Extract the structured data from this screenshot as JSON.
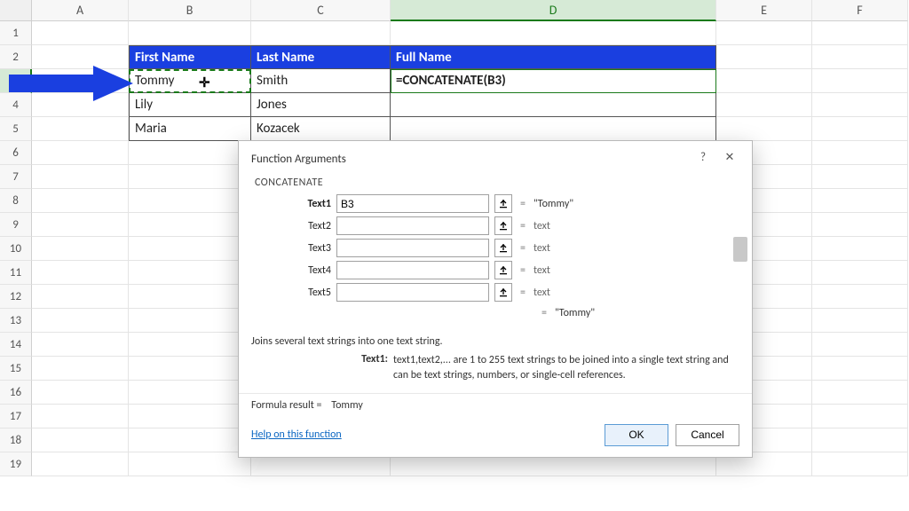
{
  "grid": {
    "columns": [
      "A",
      "B",
      "C",
      "D",
      "E",
      "F"
    ],
    "rows": 19,
    "header": {
      "first": "First Name",
      "last": "Last Name",
      "full": "Full Name"
    },
    "data": [
      {
        "first": "Tommy",
        "last": "Smith",
        "full": "=CONCATENATE(B3)"
      },
      {
        "first": "Lily",
        "last": "Jones",
        "full": ""
      },
      {
        "first": "Maria",
        "last": "Kozacek",
        "full": ""
      }
    ],
    "selected_col": "D",
    "selected_row": 3
  },
  "dialog": {
    "title": "Function Arguments",
    "fn": "CONCATENATE",
    "args": [
      {
        "label": "Text1",
        "value": "B3",
        "bold": true,
        "preview": "\"Tommy\"",
        "preview_val": true
      },
      {
        "label": "Text2",
        "value": "",
        "bold": false,
        "preview": "text",
        "preview_val": false
      },
      {
        "label": "Text3",
        "value": "",
        "bold": false,
        "preview": "text",
        "preview_val": false
      },
      {
        "label": "Text4",
        "value": "",
        "bold": false,
        "preview": "text",
        "preview_val": false
      },
      {
        "label": "Text5",
        "value": "",
        "bold": false,
        "preview": "text",
        "preview_val": false
      }
    ],
    "result_preview": "\"Tommy\"",
    "description": "Joins several text strings into one text string.",
    "arg_desc_key": "Text1:",
    "arg_desc_val": "text1,text2,... are 1 to 255 text strings to be joined into a single text string and can be text strings, numbers, or single-cell references.",
    "formula_result_label": "Formula result =",
    "formula_result": "Tommy",
    "help_link": "Help on this function",
    "ok": "OK",
    "cancel": "Cancel",
    "eq": "="
  }
}
